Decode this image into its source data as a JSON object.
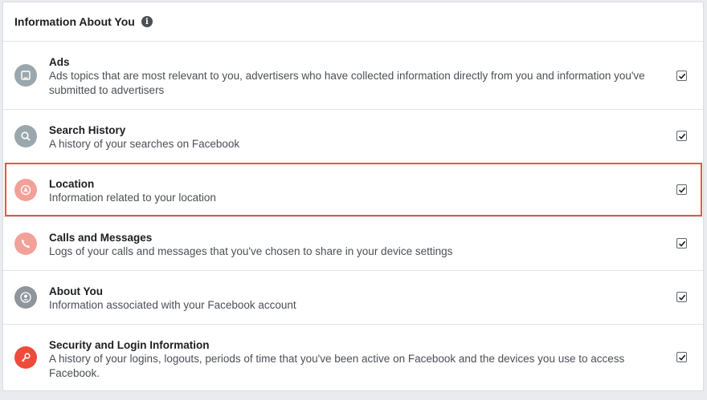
{
  "header": {
    "title": "Information About You",
    "info_icon": "info-icon"
  },
  "rows": [
    {
      "title": "Ads",
      "desc": "Ads topics that are most relevant to you, advertisers who have collected information directly from you and information you've submitted to advertisers",
      "checked": true,
      "icon": "ads-icon",
      "color": "#9aa7ad"
    },
    {
      "title": "Search History",
      "desc": "A history of your searches on Facebook",
      "checked": true,
      "icon": "search-icon",
      "color": "#9aa7ad"
    },
    {
      "title": "Location",
      "desc": "Information related to your location",
      "checked": true,
      "icon": "location-icon",
      "color": "#f2a199"
    },
    {
      "title": "Calls and Messages",
      "desc": "Logs of your calls and messages that you've chosen to share in your device settings",
      "checked": true,
      "icon": "phone-icon",
      "color": "#f2a199"
    },
    {
      "title": "About You",
      "desc": "Information associated with your Facebook account",
      "checked": true,
      "icon": "profile-icon",
      "color": "#8e959b"
    },
    {
      "title": "Security and Login Information",
      "desc": "A history of your logins, logouts, periods of time that you've been active on Facebook and the devices you use to access Facebook.",
      "checked": true,
      "icon": "key-icon",
      "color": "#ee4b3b"
    }
  ],
  "highlight_color": "#e8554e"
}
